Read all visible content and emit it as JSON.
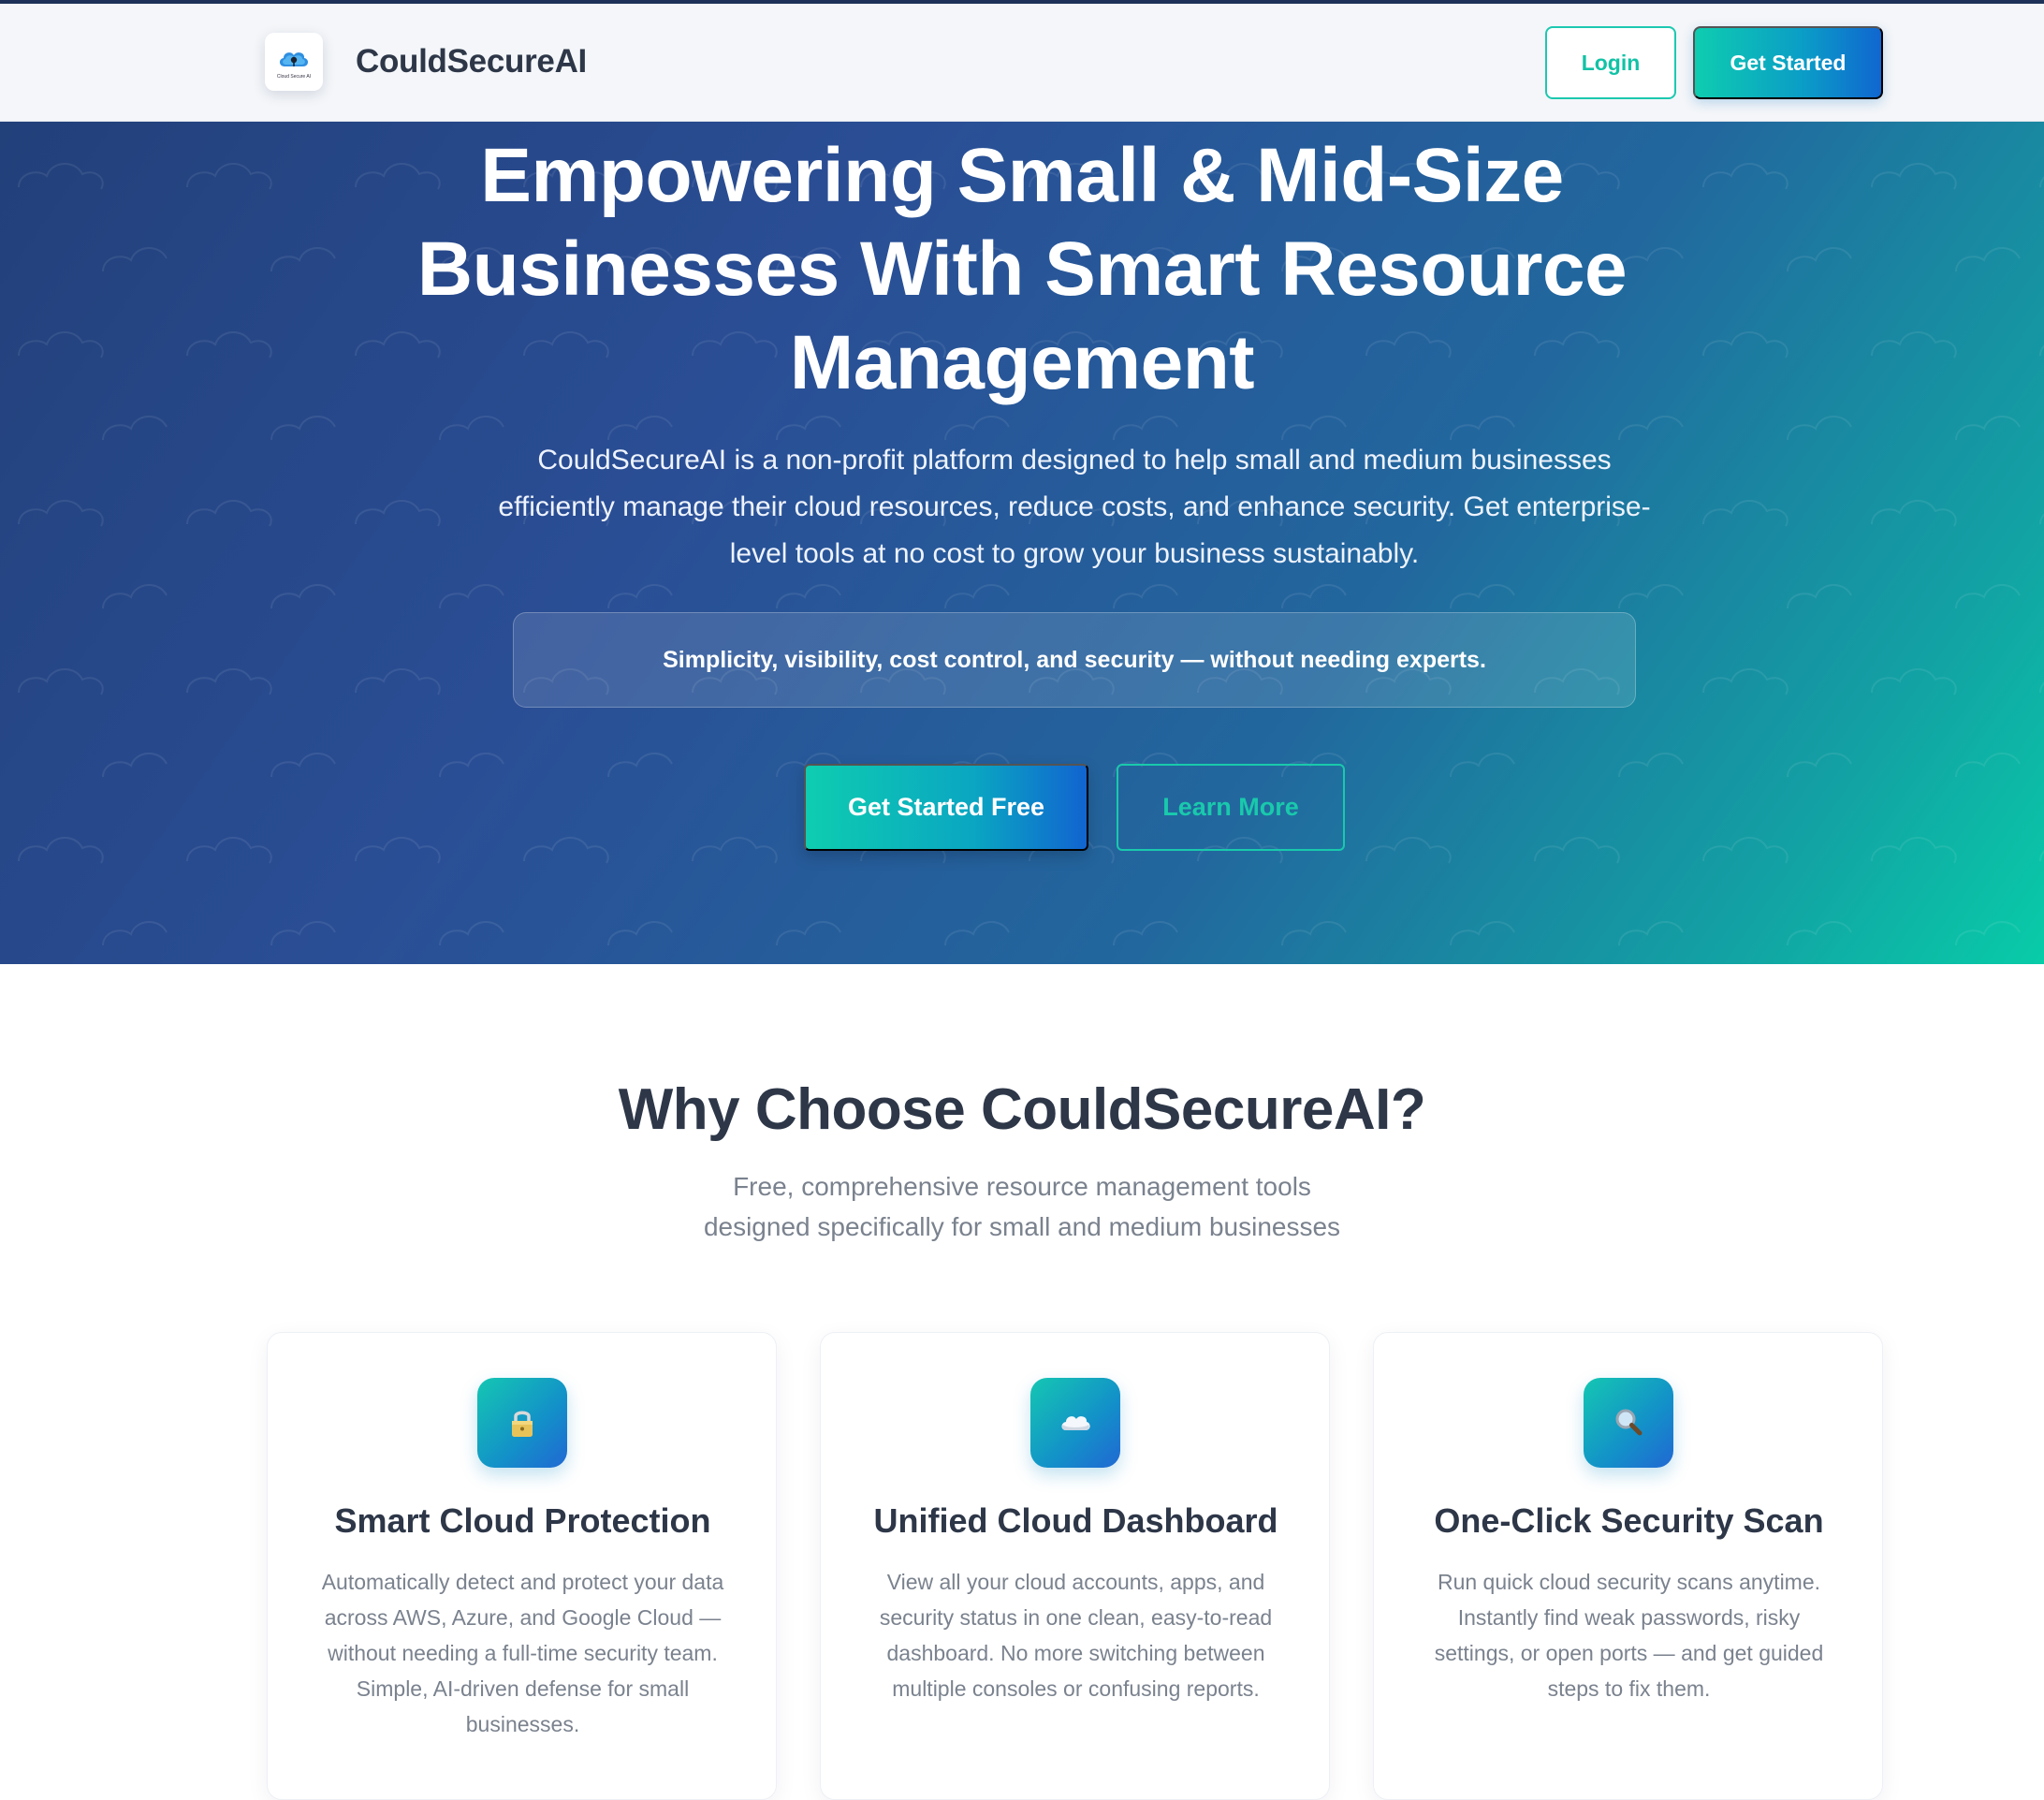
{
  "header": {
    "logo_caption": "Cloud Secure AI",
    "brand_name": "CouldSecureAI",
    "login_label": "Login",
    "get_started_label": "Get Started"
  },
  "hero": {
    "title": "Empowering Small & Mid-Size Businesses With Smart Resource Management",
    "description": "CouldSecureAI is a non-profit platform designed to help small and medium businesses efficiently manage their cloud resources, reduce costs, and enhance security. Get enterprise-level tools at no cost to grow your business sustainably.",
    "tagline": "Simplicity, visibility, cost control, and security — without needing experts.",
    "primary_cta": "Get Started Free",
    "secondary_cta": "Learn More"
  },
  "features": {
    "title": "Why Choose CouldSecureAI?",
    "subtitle": "Free, comprehensive resource management tools designed specifically for small and medium businesses",
    "cards": [
      {
        "icon": "lock-icon",
        "title": "Smart Cloud Protection",
        "text": "Automatically detect and protect your data across AWS, Azure, and Google Cloud — without needing a full-time security team. Simple, AI-driven defense for small businesses."
      },
      {
        "icon": "cloud-icon",
        "title": "Unified Cloud Dashboard",
        "text": "View all your cloud accounts, apps, and security status in one clean, easy-to-read dashboard. No more switching between multiple consoles or confusing reports."
      },
      {
        "icon": "magnifier-icon",
        "title": "One-Click Security Scan",
        "text": "Run quick cloud security scans anytime. Instantly find weak passwords, risky settings, or open ports — and get guided steps to fix them."
      }
    ]
  },
  "colors": {
    "accent_teal": "#12c2a6",
    "brand_blue": "#1066d0",
    "hero_start": "#22407a",
    "hero_end": "#08cca8",
    "heading": "#2d3748",
    "muted_text": "#7a828e"
  }
}
